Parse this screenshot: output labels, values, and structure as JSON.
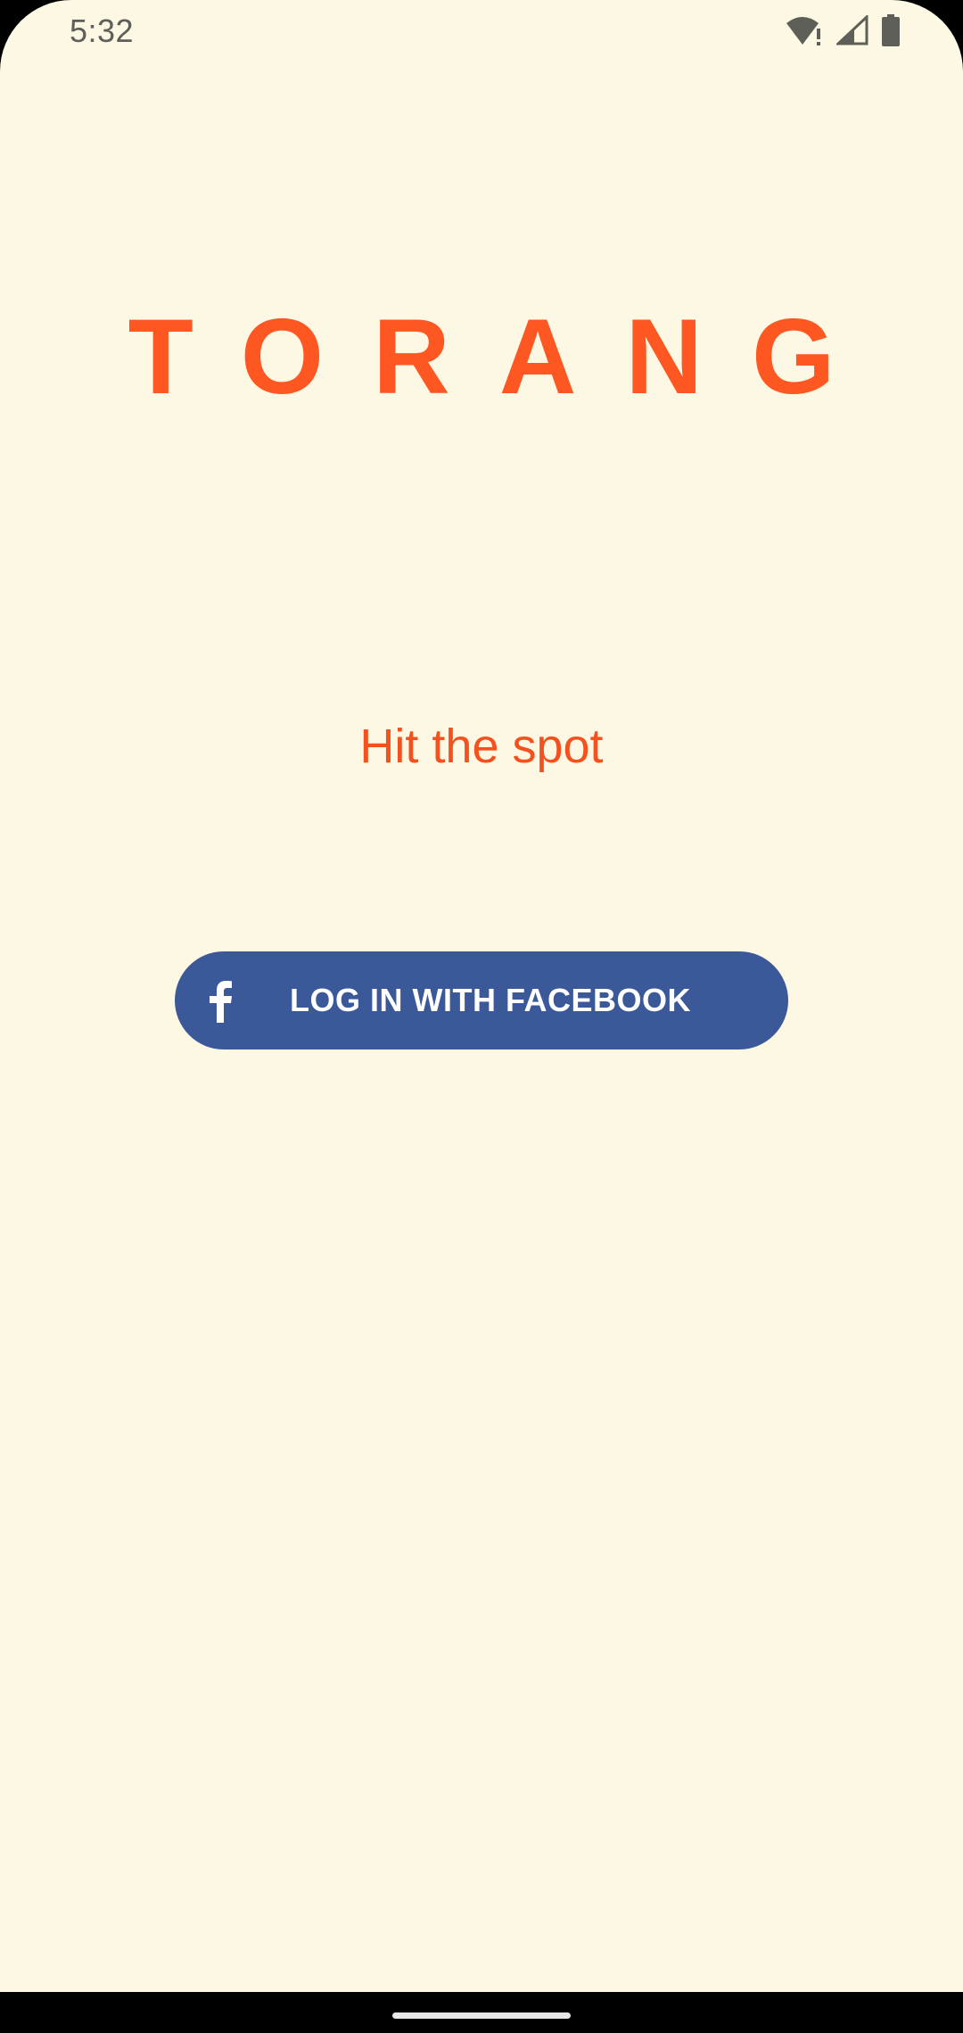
{
  "status_bar": {
    "time": "5:32",
    "icons": [
      "wifi-alert-icon",
      "cellular-signal-icon",
      "battery-icon"
    ]
  },
  "brand": {
    "title": "TORANG",
    "tagline": "Hit the spot",
    "accent_color": "#FF5722"
  },
  "login": {
    "facebook_button_label": "LOG IN WITH FACEBOOK",
    "facebook_icon": "facebook-f-icon",
    "button_color": "#3B5998"
  },
  "theme": {
    "background": "#FDF8E4"
  }
}
